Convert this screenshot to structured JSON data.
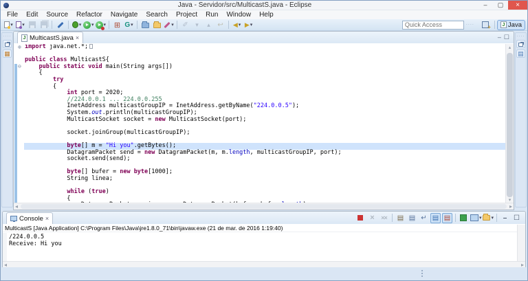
{
  "window": {
    "title": "Java - Servidor/src/MulticastS.java - Eclipse",
    "controls": {
      "minimize": "–",
      "maximize": "▢",
      "close": "×"
    }
  },
  "menu": {
    "items": [
      "File",
      "Edit",
      "Source",
      "Refactor",
      "Navigate",
      "Search",
      "Project",
      "Run",
      "Window",
      "Help"
    ]
  },
  "toolbar": {
    "quick_access_placeholder": "Quick Access",
    "perspective_label": "Java",
    "perspective_icon_letter": "J",
    "icons": [
      {
        "name": "new-wizard-icon",
        "cls": "i-new",
        "dd": true
      },
      {
        "name": "new-java-project-icon",
        "cls": "i-newproj",
        "dd": true
      },
      {
        "name": "save-icon",
        "cls": "i-save",
        "disabled": true
      },
      {
        "name": "save-all-icon",
        "cls": "i-saveall",
        "disabled": true
      },
      {
        "sep": true
      },
      {
        "name": "pencil-icon",
        "cls": "i-pencil"
      },
      {
        "sep": true
      },
      {
        "name": "debug-icon",
        "cls": "i-debug",
        "dd": true
      },
      {
        "name": "run-icon",
        "cls": "i-run",
        "dd": true
      },
      {
        "name": "run-coverage-icon",
        "cls": "i-coverage",
        "dd": true
      },
      {
        "sep": true
      },
      {
        "name": "new-project-grid-icon",
        "cls": "i-grid"
      },
      {
        "name": "server-g-icon",
        "cls": "i-g",
        "dd": true
      },
      {
        "sep": true
      },
      {
        "name": "open-folder-blue-icon",
        "cls": "i-folder1"
      },
      {
        "name": "open-folder-yellow-icon",
        "cls": "i-folder2"
      },
      {
        "name": "search-brush-icon",
        "cls": "i-brush",
        "dd": true
      },
      {
        "sep": true
      },
      {
        "name": "mark-occurrences-icon",
        "cls": "i-key",
        "disabled": true
      },
      {
        "name": "next-annotation-icon",
        "cls": "i-next",
        "disabled": true
      },
      {
        "name": "previous-annotation-icon",
        "cls": "i-prev",
        "disabled": true
      },
      {
        "name": "last-edit-location-icon",
        "cls": "i-lastedit",
        "disabled": true
      },
      {
        "sep": true
      },
      {
        "name": "back-icon",
        "cls": "i-back",
        "dd": true
      },
      {
        "name": "forward-icon",
        "cls": "i-fwd",
        "dd": true
      }
    ]
  },
  "sidebars": {
    "left_view": "Package Explorer (minimized)",
    "right_view": "Outline (minimized)"
  },
  "editor": {
    "tab_label": "MulticastS.java",
    "tab_close": "×",
    "file_icon_letter": "J",
    "minimize_glyph": "–",
    "maximize_glyph": "☐",
    "scroll_up_glyph": "▴",
    "scroll_down_glyph": "▾",
    "scroll_left_glyph": "◂",
    "scroll_right_glyph": "▸",
    "code_lines": [
      {
        "fold": "plus",
        "segs": [
          [
            "kw",
            "import"
          ],
          [
            "pl",
            " java.net.*;"
          ],
          [
            "box",
            ""
          ]
        ]
      },
      {
        "segs": []
      },
      {
        "segs": [
          [
            "kw",
            "public"
          ],
          [
            "pl",
            " "
          ],
          [
            "kw",
            "class"
          ],
          [
            "pl",
            " MulticastS{"
          ]
        ]
      },
      {
        "fold": "minus",
        "segs": [
          [
            "pl",
            "    "
          ],
          [
            "kw",
            "public"
          ],
          [
            "pl",
            " "
          ],
          [
            "kw",
            "static"
          ],
          [
            "pl",
            " "
          ],
          [
            "kw",
            "void"
          ],
          [
            "pl",
            " main(String args[])"
          ]
        ]
      },
      {
        "segs": [
          [
            "pl",
            "    {"
          ]
        ]
      },
      {
        "segs": [
          [
            "pl",
            "        "
          ],
          [
            "kw",
            "try"
          ]
        ]
      },
      {
        "segs": [
          [
            "pl",
            "        {"
          ]
        ]
      },
      {
        "segs": [
          [
            "pl",
            "            "
          ],
          [
            "kw",
            "int"
          ],
          [
            "pl",
            " port = 2020;"
          ]
        ]
      },
      {
        "segs": [
          [
            "pl",
            "            "
          ],
          [
            "com",
            "//224.0.0.1 ... 224.0.0.255"
          ]
        ]
      },
      {
        "segs": [
          [
            "pl",
            "            InetAddress multicastGroupIP = InetAddress.getByName("
          ],
          [
            "str",
            "\"224.0.0.5\""
          ],
          [
            "pl",
            ");"
          ]
        ]
      },
      {
        "segs": [
          [
            "pl",
            "            System."
          ],
          [
            "sf",
            "out"
          ],
          [
            "pl",
            ".println(multicastGroupIP);"
          ]
        ]
      },
      {
        "segs": [
          [
            "pl",
            "            MulticastSocket socket = "
          ],
          [
            "kw",
            "new"
          ],
          [
            "pl",
            " MulticastSocket(port);"
          ]
        ]
      },
      {
        "segs": []
      },
      {
        "segs": [
          [
            "pl",
            "            socket.joinGroup(multicastGroupIP);"
          ]
        ]
      },
      {
        "segs": []
      },
      {
        "cur": true,
        "segs": [
          [
            "pl",
            "            "
          ],
          [
            "kw",
            "byte"
          ],
          [
            "pl",
            "[] m = "
          ],
          [
            "str",
            "\"Hi you\""
          ],
          [
            "pl",
            ".getBytes();"
          ]
        ]
      },
      {
        "segs": [
          [
            "pl",
            "            DatagramPacket send = "
          ],
          [
            "kw",
            "new"
          ],
          [
            "pl",
            " DatagramPacket(m, m."
          ],
          [
            "fd",
            "length"
          ],
          [
            "pl",
            ", multicastGroupIP, port);"
          ]
        ]
      },
      {
        "segs": [
          [
            "pl",
            "            socket.send(send);"
          ]
        ]
      },
      {
        "segs": []
      },
      {
        "segs": [
          [
            "pl",
            "            "
          ],
          [
            "kw",
            "byte"
          ],
          [
            "pl",
            "[] bufer = "
          ],
          [
            "kw",
            "new"
          ],
          [
            "pl",
            " "
          ],
          [
            "kw",
            "byte"
          ],
          [
            "pl",
            "[1000];"
          ]
        ]
      },
      {
        "segs": [
          [
            "pl",
            "            String linea;"
          ]
        ]
      },
      {
        "segs": []
      },
      {
        "segs": [
          [
            "pl",
            "            "
          ],
          [
            "kw",
            "while"
          ],
          [
            "pl",
            " ("
          ],
          [
            "kw",
            "true"
          ],
          [
            "pl",
            ")"
          ]
        ]
      },
      {
        "segs": [
          [
            "pl",
            "            {"
          ]
        ]
      },
      {
        "segs": [
          [
            "pl",
            "                DatagramPacket receive = "
          ],
          [
            "kw",
            "new"
          ],
          [
            "pl",
            " DatagramPacket(bufer, bufer."
          ],
          [
            "fd",
            "length"
          ],
          [
            "pl",
            ");"
          ]
        ]
      }
    ]
  },
  "console": {
    "tab_label": "Console",
    "tab_close": "×",
    "process_label": "MulticastS [Java Application] C:\\Program Files\\Java\\jre1.8.0_71\\bin\\javaw.exe (21 de mar. de 2016 1:19:40)",
    "output_lines": [
      "/224.0.0.5",
      "Receive: Hi you"
    ],
    "scroll_left_glyph": "◂",
    "scroll_right_glyph": "▸",
    "icons": [
      {
        "name": "terminate-icon",
        "cls": "c-term"
      },
      {
        "name": "remove-launch-icon",
        "cls": "c-x",
        "disabled": true
      },
      {
        "name": "remove-all-launches-icon",
        "cls": "c-xx",
        "disabled": true
      },
      {
        "sep": true
      },
      {
        "name": "clear-console-icon",
        "cls": "c-clear"
      },
      {
        "name": "scroll-lock-icon",
        "cls": "c-lock"
      },
      {
        "name": "word-wrap-icon",
        "cls": "c-wrap"
      },
      {
        "name": "show-stdout-when-changed-icon",
        "cls": "c-stdout",
        "active": true
      },
      {
        "name": "show-stderr-when-changed-icon",
        "cls": "c-stderr",
        "active": true
      },
      {
        "sep": true
      },
      {
        "name": "pin-console-icon",
        "cls": "c-pin"
      },
      {
        "name": "display-selected-console-icon",
        "cls": "c-display",
        "dd": true
      },
      {
        "name": "open-console-icon",
        "cls": "c-open",
        "dd": true
      },
      {
        "sep": true
      },
      {
        "name": "minimize-view-icon",
        "cls": "c-min"
      },
      {
        "name": "maximize-view-icon",
        "cls": "c-max"
      }
    ]
  },
  "colors": {
    "keyword": "#7f0055",
    "string": "#2a00ff",
    "comment": "#3f7f5f",
    "field": "#0000c0",
    "current_line_highlight": "#cfe3fc",
    "close_button": "#e0564d",
    "toolbar_bg": "#dce8f5",
    "range_indicator": "#9cc3e8"
  }
}
